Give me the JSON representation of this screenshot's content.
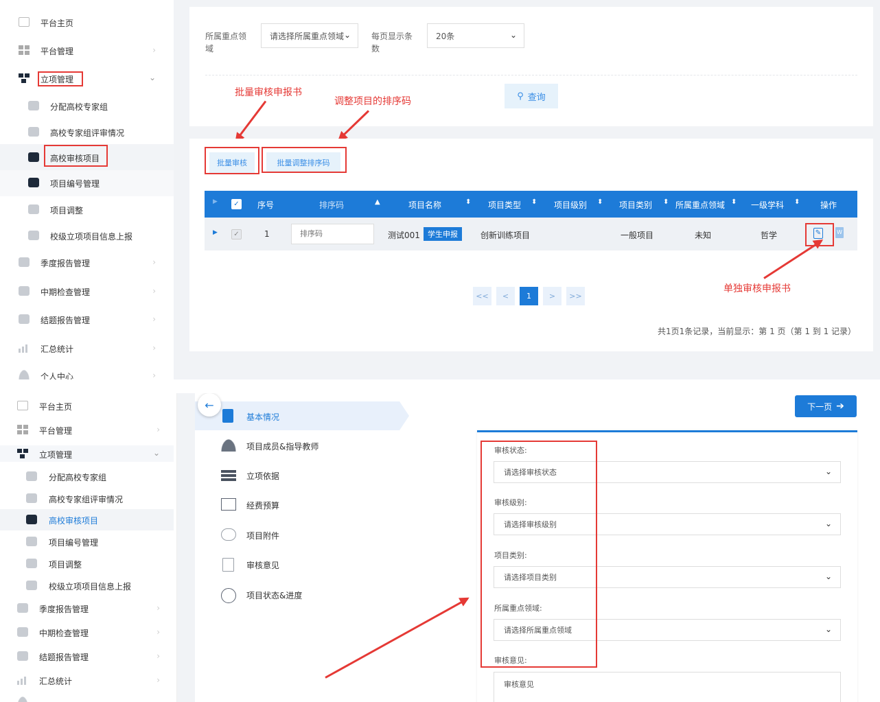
{
  "shot1": {
    "sidebar": [
      {
        "label": "平台主页",
        "icon": "home-icon"
      },
      {
        "label": "平台管理",
        "icon": "windows-icon",
        "chevron": "›"
      },
      {
        "label": "立项管理",
        "icon": "tree-icon",
        "chevron": "⌄"
      },
      {
        "label": "分配高校专家组",
        "icon": "cube-icon"
      },
      {
        "label": "高校专家组评审情况",
        "icon": "cube-icon"
      },
      {
        "label": "高校审核项目",
        "icon": "cube-icon"
      },
      {
        "label": "项目编号管理",
        "icon": "cube-icon"
      },
      {
        "label": "项目调整",
        "icon": "cube-icon"
      },
      {
        "label": "校级立项项目信息上报",
        "icon": "cube-icon"
      },
      {
        "label": "季度报告管理",
        "icon": "cube-icon",
        "chevron": "›"
      },
      {
        "label": "中期检查管理",
        "icon": "cube-icon",
        "chevron": "›"
      },
      {
        "label": "结题报告管理",
        "icon": "cube-icon",
        "chevron": "›"
      },
      {
        "label": "汇总统计",
        "icon": "chart-icon",
        "chevron": "›"
      },
      {
        "label": "个人中心",
        "icon": "user-icon",
        "chevron": "›"
      }
    ],
    "filters": {
      "field_label": "所属重点领域",
      "field_value": "请选择所属重点领域",
      "page_size_label": "每页显示条数",
      "page_size_value": "20条",
      "query_label": "查询"
    },
    "annotations": {
      "batch_review": "批量审核申报书",
      "adjust_sort": "调整项目的排序码",
      "single_review": "单独审核申报书"
    },
    "toolbar": {
      "batch_review": "批量审核",
      "batch_sort": "批量调整排序码"
    },
    "table": {
      "headers": [
        "序号",
        "排序码",
        "项目名称",
        "项目类型",
        "项目级别",
        "项目类别",
        "所属重点领域",
        "一级学科",
        "操作"
      ],
      "row": {
        "index": "1",
        "sort_placeholder": "排序码",
        "name": "测试001",
        "badge": "学生申报",
        "type": "创新训练项目",
        "category": "一般项目",
        "field": "未知",
        "subject": "哲学"
      }
    },
    "pagination": {
      "first": "<<",
      "prev": "<",
      "current": "1",
      "next": ">",
      "last": ">>"
    },
    "summary": "共1页1条记录，当前显示：第 1 页（第 1 到 1 记录）"
  },
  "shot2": {
    "sidebar": [
      {
        "label": "平台主页"
      },
      {
        "label": "平台管理",
        "chevron": "›"
      },
      {
        "label": "立项管理",
        "chevron": "⌄"
      },
      {
        "label": "分配高校专家组"
      },
      {
        "label": "高校专家组评审情况"
      },
      {
        "label": "高校审核项目"
      },
      {
        "label": "项目编号管理"
      },
      {
        "label": "项目调整"
      },
      {
        "label": "校级立项项目信息上报"
      },
      {
        "label": "季度报告管理",
        "chevron": "›"
      },
      {
        "label": "中期检查管理",
        "chevron": "›"
      },
      {
        "label": "结题报告管理",
        "chevron": "›"
      },
      {
        "label": "汇总统计",
        "chevron": "›"
      }
    ],
    "steps": [
      "基本情况",
      "项目成员&指导教师",
      "立项依据",
      "经费预算",
      "项目附件",
      "审核意见",
      "项目状态&进度"
    ],
    "next_label": "下一页",
    "form": {
      "status_label": "审核状态:",
      "status_placeholder": "请选择审核状态",
      "level_label": "审核级别:",
      "level_placeholder": "请选择审核级别",
      "category_label": "项目类别:",
      "category_placeholder": "请选择项目类别",
      "field_label": "所属重点领域:",
      "field_placeholder": "请选择所属重点领域",
      "opinion_label": "审核意见:",
      "opinion_placeholder": "审核意见"
    }
  },
  "colors": {
    "primary": "#1d7bd8",
    "annotation": "#e53935",
    "light_button": "#e6f2fb"
  }
}
